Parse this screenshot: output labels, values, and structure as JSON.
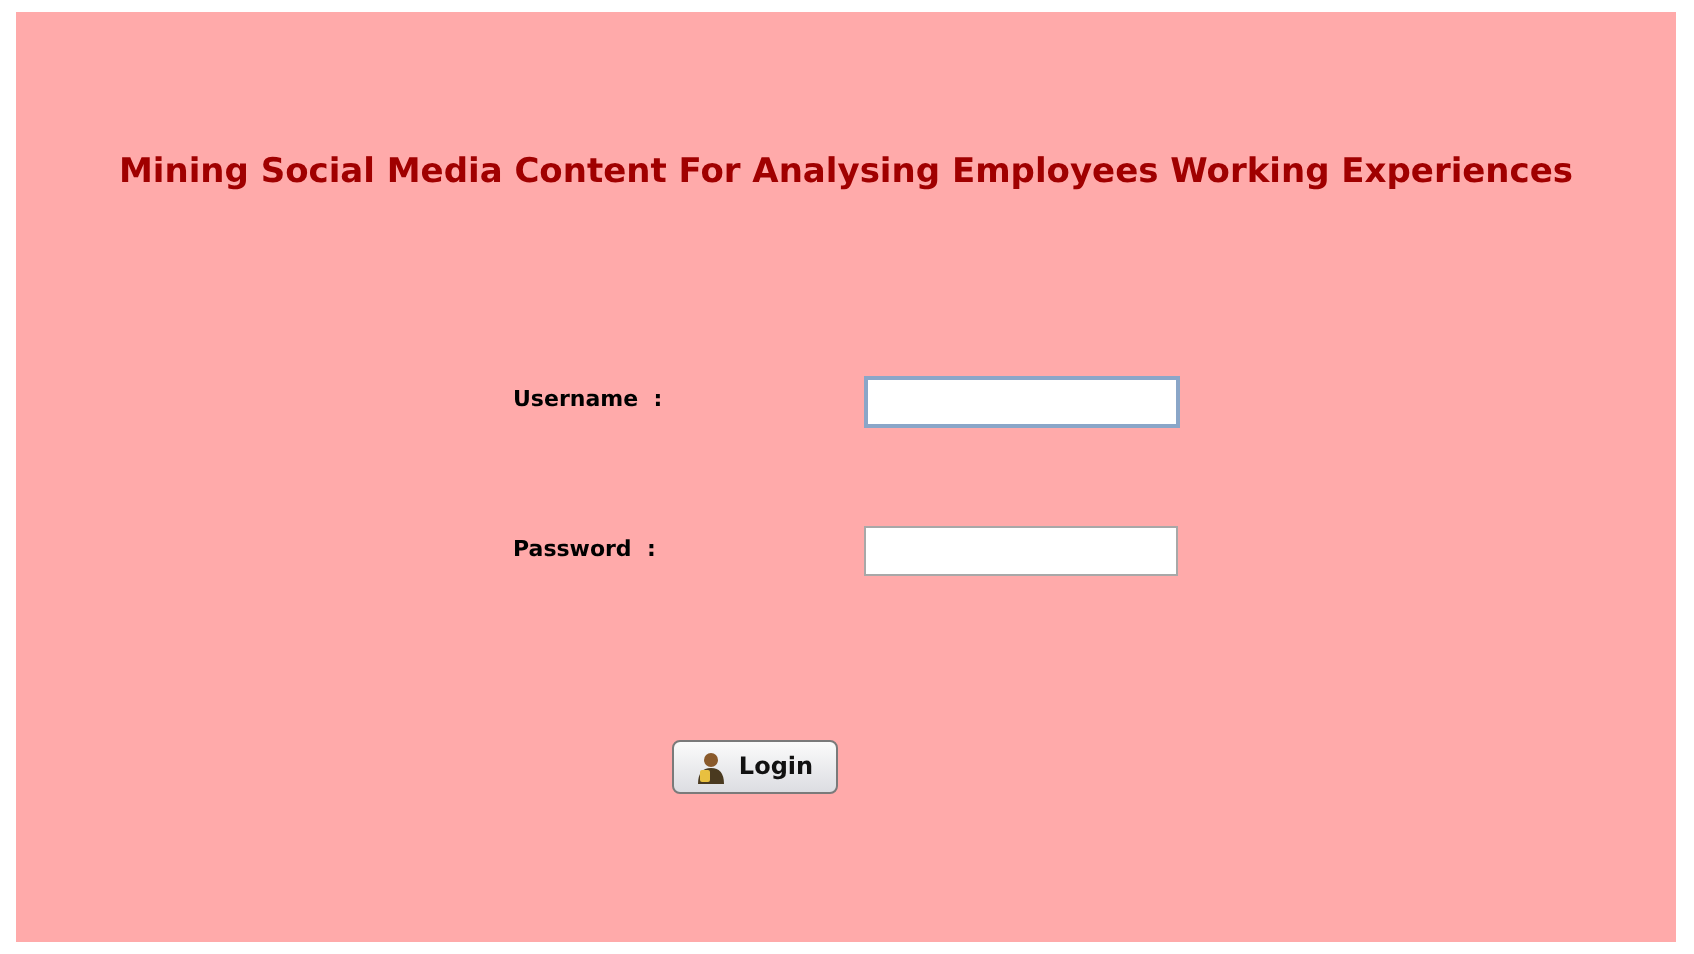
{
  "title": "Mining Social Media Content For Analysing Employees Working Experiences",
  "fields": [
    {
      "label": "Username  :",
      "focused": true
    },
    {
      "label": "Password  :",
      "focused": false
    }
  ],
  "login_button": {
    "label": "Login"
  }
}
